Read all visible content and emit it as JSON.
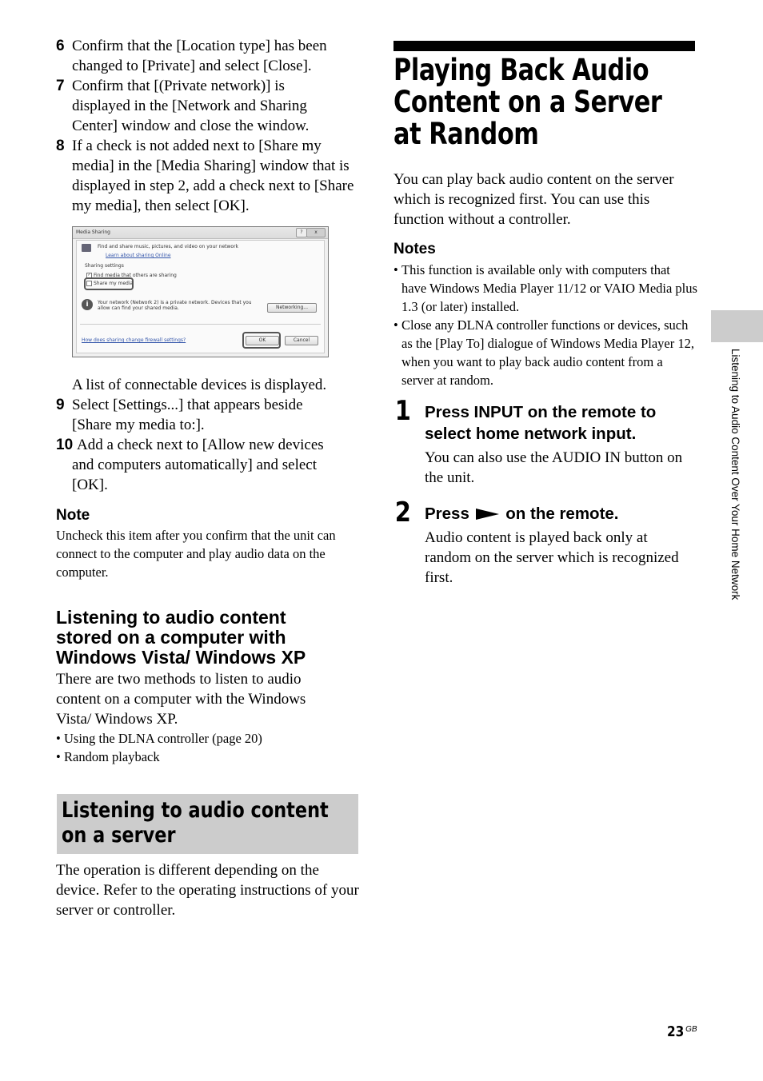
{
  "left_column": {
    "steps_top": [
      {
        "num": "6",
        "text": "Confirm that the [Location type] has been changed to [Private] and select [Close]."
      },
      {
        "num": "7",
        "text": "Confirm that [(Private network)] is displayed in the [Network and Sharing Center] window and close the window."
      },
      {
        "num": "8",
        "text": "If a check is not added next to [Share my media] in the [Media Sharing] window that is displayed in step 2, add a check next to [Share my media], then select [OK]."
      }
    ],
    "dialog": {
      "title": "Media Sharing",
      "help_btn": "?",
      "close_btn": "x",
      "description": "Find and share music, pictures, and video on your network",
      "learn_link": "Learn about sharing Online",
      "group_label": "Sharing settings",
      "find_media_label": "Find media that others are sharing",
      "find_media_checked": true,
      "share_media_label": "Share my media",
      "share_media_checked": false,
      "info_text": "Your network (Network  2) is a private network. Devices that you allow can find your shared media.",
      "networking_btn": "Networking...",
      "firewall_link": "How does sharing change firewall settings?",
      "ok_btn": "OK",
      "cancel_btn": "Cancel"
    },
    "after_dialog_text": "A list of connectable devices is displayed.",
    "steps_bottom": [
      {
        "num": "9",
        "text": "Select [Settings...] that appears beside [Share my media to:]."
      },
      {
        "num": "10",
        "text": "Add a check next to [Allow new devices and computers automatically] and select [OK]."
      }
    ],
    "note": {
      "heading": "Note",
      "text": "Uncheck this item after you confirm that the unit can connect to the computer and play audio data on the computer."
    },
    "vista_section": {
      "heading": "Listening to audio content stored on a computer with Windows Vista/ Windows XP",
      "body": "There are two methods to listen to audio content on a computer with the Windows Vista/ Windows XP.",
      "bullets": [
        "Using the DLNA controller (page 20)",
        "Random playback"
      ]
    },
    "server_section": {
      "heading": "Listening to audio content on a server",
      "body": "The operation is different depending on the device. Refer to the operating instructions of your server or controller."
    }
  },
  "right_column": {
    "title": "Playing Back Audio Content on a Server at Random",
    "intro": "You can play back audio content on the server which is recognized first. You can use this function without a controller.",
    "notes": {
      "heading": "Notes",
      "items": [
        "This function is available only with computers that have Windows Media Player 11/12 or VAIO Media plus 1.3 (or later) installed.",
        "Close any DLNA controller functions or devices, such as the [Play To] dialogue of Windows Media Player 12, when you want to play back audio content from a server at random."
      ]
    },
    "steps": [
      {
        "num": "1",
        "heading": "Press INPUT on the remote to select home network input.",
        "body": "You can also use the AUDIO IN button on the unit."
      },
      {
        "num": "2",
        "heading_before": "Press",
        "heading_icon": "play-icon",
        "heading_after": "on the remote.",
        "body": "Audio content is played back only at random on the server which is recognized first."
      }
    ]
  },
  "side_tab": {
    "label": "Listening to Audio Content Over Your Home Network"
  },
  "footer": {
    "page_number": "23",
    "page_suffix": "GB"
  }
}
